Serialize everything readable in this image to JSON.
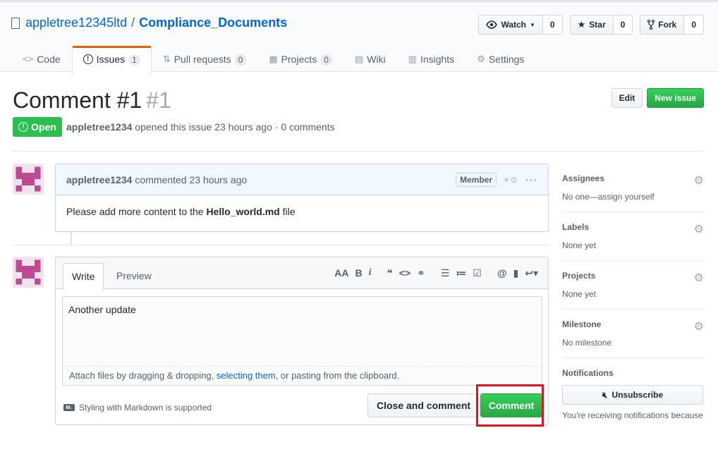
{
  "repo": {
    "owner": "appletree12345ltd",
    "separator": "/",
    "name": "Compliance_Documents"
  },
  "actions": [
    {
      "label": "Watch",
      "icon": "eye-icon",
      "count": "0"
    },
    {
      "label": "Star",
      "icon": "star-icon",
      "count": "0"
    },
    {
      "label": "Fork",
      "icon": "fork-icon",
      "count": "0"
    }
  ],
  "nav": {
    "code": "Code",
    "issues": "Issues",
    "issues_count": "1",
    "pulls": "Pull requests",
    "pulls_count": "0",
    "projects": "Projects",
    "projects_count": "0",
    "wiki": "Wiki",
    "insights": "Insights",
    "settings": "Settings"
  },
  "issue": {
    "title": "Comment #1",
    "number": "#1",
    "state": "Open",
    "author": "appletree1234",
    "meta_text": "opened this issue 23 hours ago · 0 comments",
    "edit_label": "Edit",
    "new_issue_label": "New issue"
  },
  "comment": {
    "author": "appletree1234",
    "time_text": "commented 23 hours ago",
    "badge": "Member",
    "body_prefix": "Please add more content to the ",
    "body_bold": "Hello_world.md",
    "body_suffix": " file"
  },
  "editor": {
    "write_tab": "Write",
    "preview_tab": "Preview",
    "text": "Another update",
    "drop_prefix": "Attach files by dragging & dropping, ",
    "drop_link": "selecting them",
    "drop_suffix": ", or pasting from the clipboard.",
    "markdown_note": "Styling with Markdown is supported",
    "close_label": "Close and comment",
    "comment_label": "Comment"
  },
  "sidebar": {
    "assignees_title": "Assignees",
    "assignees_value": "No one—assign yourself",
    "labels_title": "Labels",
    "labels_value": "None yet",
    "projects_title": "Projects",
    "projects_value": "None yet",
    "milestone_title": "Milestone",
    "milestone_value": "No milestone",
    "notifications_title": "Notifications",
    "unsubscribe_label": "Unsubscribe",
    "notifications_text": "You're receiving notifications because"
  },
  "colors": {
    "accent_green": "#28a745",
    "link": "#0366d6",
    "highlight": "#e0141e"
  }
}
